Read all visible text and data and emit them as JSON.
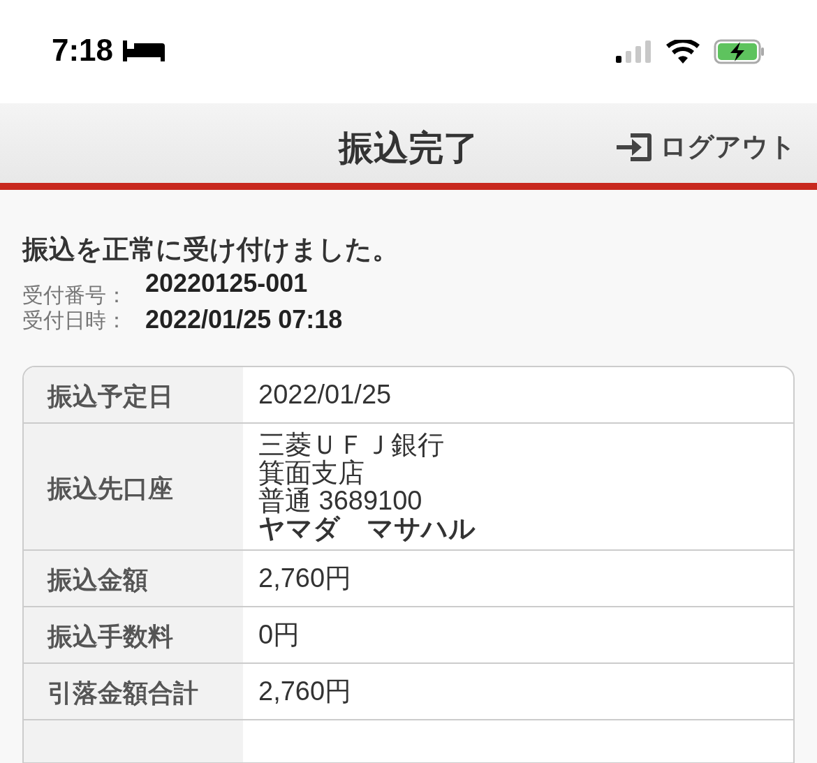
{
  "status_bar": {
    "time": "7:18"
  },
  "header": {
    "title": "振込完了",
    "logout": "ログアウト"
  },
  "message": "振込を正常に受け付けました。",
  "receipt": [
    {
      "label": "受付番号：",
      "value": "20220125-001"
    },
    {
      "label": "受付日時：",
      "value": "2022/01/25 07:18"
    }
  ],
  "details": [
    {
      "label": "振込予定日",
      "lines": [
        {
          "text": "2022/01/25",
          "bold": false
        }
      ]
    },
    {
      "label": "振込先口座",
      "lines": [
        {
          "text": "三菱ＵＦＪ銀行",
          "bold": false
        },
        {
          "text": "箕面支店",
          "bold": false
        },
        {
          "text": "普通 3689100",
          "bold": false
        },
        {
          "text": "ヤマダ　マサハル",
          "bold": true
        }
      ]
    },
    {
      "label": "振込金額",
      "lines": [
        {
          "text": "2,760円",
          "bold": false
        }
      ]
    },
    {
      "label": "振込手数料",
      "lines": [
        {
          "text": "0円",
          "bold": false
        }
      ]
    },
    {
      "label": "引落金額合計",
      "lines": [
        {
          "text": "2,760円",
          "bold": false
        }
      ]
    }
  ]
}
